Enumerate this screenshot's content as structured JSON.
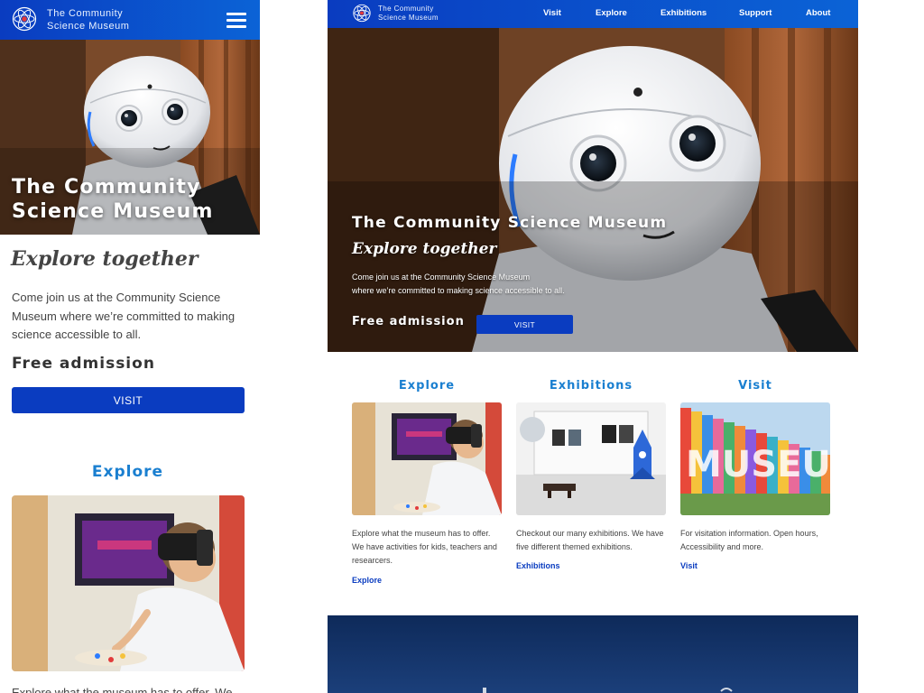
{
  "site": {
    "name_line1": "The Community",
    "name_line2": "Science Museum"
  },
  "mobile": {
    "hero_title": "The Community Science Museum",
    "tagline": "Explore together",
    "intro": "Come join us at the Community Science Museum where we’re committed to making science accessible to all.",
    "free_admission": "Free admission",
    "visit_button": "VISIT",
    "explore_heading": "Explore",
    "explore_text": "Explore what the museum has to offer. We"
  },
  "desktop": {
    "nav": [
      "Visit",
      "Explore",
      "Exhibitions",
      "Support",
      "About"
    ],
    "hero_title": "The Community Science Museum",
    "tagline": "Explore together",
    "intro_line1": "Come join us at the Community Science Museum",
    "intro_line2": "where we’re committed to making science accessible to all.",
    "free_admission": "Free admission",
    "visit_button": "VISIT",
    "cards": [
      {
        "heading": "Explore",
        "text": "Explore what the museum has to offer. We have activities for kids, teachers and researcers.",
        "link": "Explore"
      },
      {
        "heading": "Exhibitions",
        "text": "Checkout our many exhibitions. We have five different themed exhibitions.",
        "link": "Exhibitions"
      },
      {
        "heading": "Visit",
        "text": "For visitation information. Open hours, Accessibility and more.",
        "link": "Visit"
      }
    ]
  },
  "colors": {
    "header_blue": "#0a3cc0",
    "accent_blue": "#1a7fd0",
    "button_blue": "#0a3cc0"
  },
  "images": {
    "museum_sign_text": "MUSEUM"
  }
}
